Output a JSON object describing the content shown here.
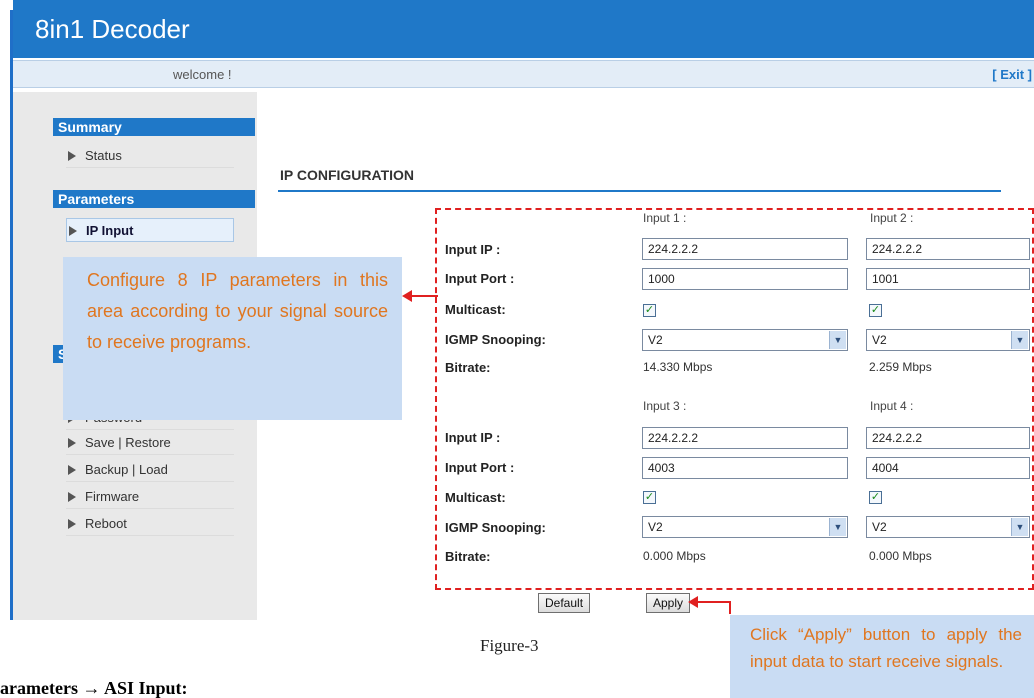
{
  "app": {
    "title": "8in1 Decoder",
    "welcome": "welcome !",
    "exit": "[ Exit ]"
  },
  "sidebar": {
    "sections": [
      {
        "title": "Summary",
        "items": [
          "Status"
        ]
      },
      {
        "title": "Parameters",
        "items": [
          "IP Input"
        ]
      },
      {
        "title": "S",
        "items": [
          "Password",
          "Save | Restore",
          "Backup | Load",
          "Firmware",
          "Reboot"
        ]
      }
    ],
    "active_item": "IP Input"
  },
  "content": {
    "title": "IP CONFIGURATION",
    "labels": {
      "input_ip": "Input IP :",
      "input_port": "Input Port :",
      "multicast": "Multicast:",
      "igmp": "IGMP Snooping:",
      "bitrate": "Bitrate:"
    },
    "inputs": [
      {
        "header": "Input 1 :",
        "ip": "224.2.2.2",
        "port": "1000",
        "multicast": true,
        "igmp": "V2",
        "bitrate": "14.330 Mbps"
      },
      {
        "header": "Input 2 :",
        "ip": "224.2.2.2",
        "port": "1001",
        "multicast": true,
        "igmp": "V2",
        "bitrate": "2.259 Mbps"
      },
      {
        "header": "Input 3 :",
        "ip": "224.2.2.2",
        "port": "4003",
        "multicast": true,
        "igmp": "V2",
        "bitrate": "0.000 Mbps"
      },
      {
        "header": "Input 4 :",
        "ip": "224.2.2.2",
        "port": "4004",
        "multicast": true,
        "igmp": "V2",
        "bitrate": "0.000 Mbps"
      }
    ],
    "buttons": {
      "default": "Default",
      "apply": "Apply"
    }
  },
  "annotations": {
    "config_note": "Configure 8 IP parameters in this area according to your signal source to receive programs.",
    "apply_note": "Click “Apply” button to apply the input data to start receive signals.",
    "accent_color": "#e0761f",
    "arrow_color": "#e02020"
  },
  "document": {
    "caption": "Figure-3",
    "heading": "arameters  →  ASI Input:"
  }
}
